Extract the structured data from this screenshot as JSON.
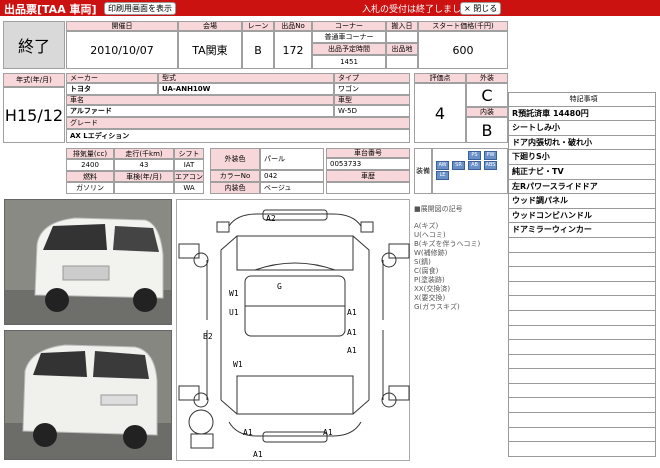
{
  "header": {
    "title": "出品票[TAA 車両]",
    "print_button": "印刷用画面を表示",
    "notice": "入札の受付は終了しました。",
    "close_button": "× 閉じる"
  },
  "status": "終了",
  "top_table": {
    "labels": [
      "開催日",
      "会場",
      "レーン",
      "出品No",
      "コーナー",
      "搬入日",
      "スタート価格(千円)"
    ],
    "date": "2010/10/07",
    "venue": "TA関東",
    "lane": "B",
    "lot_no": "172",
    "corner": "普通車コーナー",
    "scheduled_time_label": "出品予定時間",
    "scheduled_time": "1451",
    "venue_location_label": "出品地",
    "start_price": "600"
  },
  "vehicle": {
    "year_label": "年式(年/月)",
    "year": "H15/12",
    "maker_label": "メーカー",
    "maker": "トヨタ",
    "model_label": "型式",
    "model": "UA-ANH10W",
    "type_label": "タイプ",
    "type": "ワゴン",
    "name_label": "車名",
    "name": "アルファード",
    "body_label": "車型",
    "body": "W-5D",
    "grade_label": "グレード",
    "grade": "AX Lエディション",
    "rating_label": "評価点",
    "rating": "4",
    "exterior_label": "外装",
    "exterior": "C",
    "interior_label": "内装",
    "interior": "B"
  },
  "specs": {
    "labels": [
      "排気量(cc)",
      "走行(千km)",
      "シフト",
      "燃料",
      "車検(年/月)",
      "エアコン"
    ],
    "displacement": "2400",
    "mileage": "43",
    "shift": "IAT",
    "fuel": "ガソリン",
    "inspection": "",
    "aircon": "WA",
    "ext_color_label": "外装色",
    "ext_color": "パール",
    "color_no_label": "カラーNo",
    "color_no": "042",
    "int_color_label": "内装色",
    "int_color": "ベージュ",
    "chassis_label": "車台番号",
    "chassis": "0053733",
    "history_label": "車歴",
    "equipment_label": "装備",
    "equipment": [
      "PS",
      "PW",
      "AW",
      "SR",
      "AB",
      "ABS",
      "LE"
    ]
  },
  "legend": {
    "title": "■展開図の記号",
    "items": [
      "A(キズ)",
      "U(ヘコミ)",
      "B(キズを伴うヘコミ)",
      "W(補修跡)",
      "S(錆)",
      "C(腐食)",
      "P(塗装跡)",
      "XX(交換済)",
      "X(要交換)",
      "G(ガラスキズ)"
    ]
  },
  "diagram_labels": [
    "A2",
    "G",
    "W1",
    "U1",
    "A1",
    "A1",
    "B2",
    "A1",
    "W1",
    "A1",
    "A1",
    "A1"
  ],
  "notes": {
    "header": "特記事項",
    "items": [
      "R預託済車 14480円",
      "シートしみ小",
      "ドア内張切れ・破れ小",
      "下廻りS小",
      "純正ナビ・TV",
      "左Rパワースライドドア",
      "ウッド調パネル",
      "ウッドコンビハンドル",
      "ドアミラーウィンカー",
      "",
      "",
      "",
      "",
      "",
      "",
      "",
      "",
      "",
      "",
      "",
      "",
      "",
      "",
      "",
      "",
      ""
    ]
  },
  "colors": {
    "brand": "#cc1111",
    "label_bg": "#f8d7da",
    "status_bg": "#d9d9d9"
  }
}
